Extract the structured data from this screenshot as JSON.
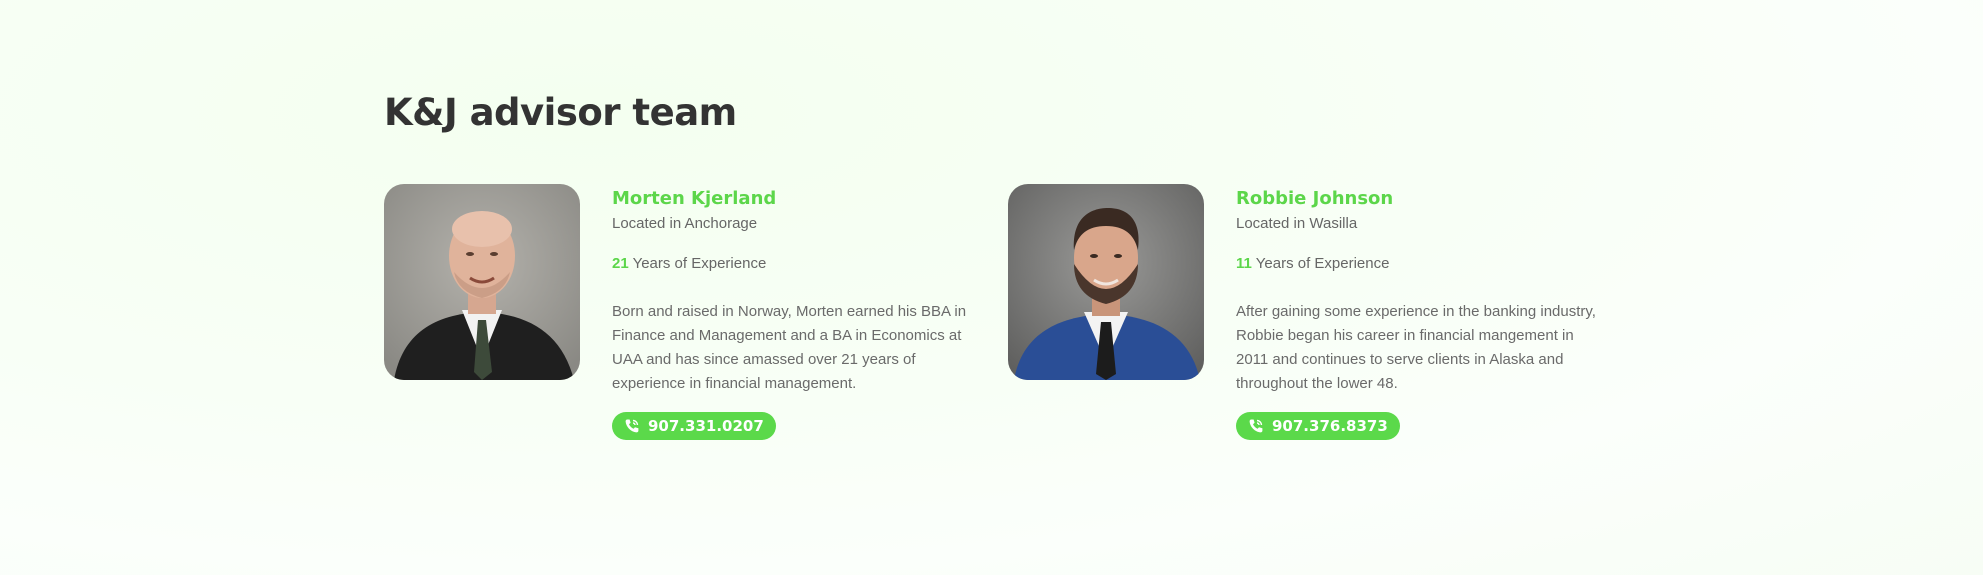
{
  "section": {
    "title": "K&J advisor team"
  },
  "advisors": [
    {
      "name": "Morten Kjerland",
      "location": "Located in Anchorage",
      "years": "21",
      "years_suffix": " Years of Experience",
      "bio": "Born and raised in Norway, Morten earned his BBA in Finance and Management and a BA in Economics at UAA and has since amassed over 21 years of experience in financial management.",
      "phone": "907.331.0207",
      "phone_icon": "phone-icon"
    },
    {
      "name": "Robbie Johnson",
      "location": "Located in Wasilla",
      "years": "11",
      "years_suffix": " Years of Experience",
      "bio": "After gaining some experience in the banking industry, Robbie began his career in financial mangement in 2011 and continues to serve clients in Alaska and throughout the lower 48.",
      "phone": "907.376.8373",
      "phone_icon": "phone-icon"
    }
  ],
  "colors": {
    "accent": "#5cd64a",
    "title": "#333333",
    "text": "#666666"
  }
}
